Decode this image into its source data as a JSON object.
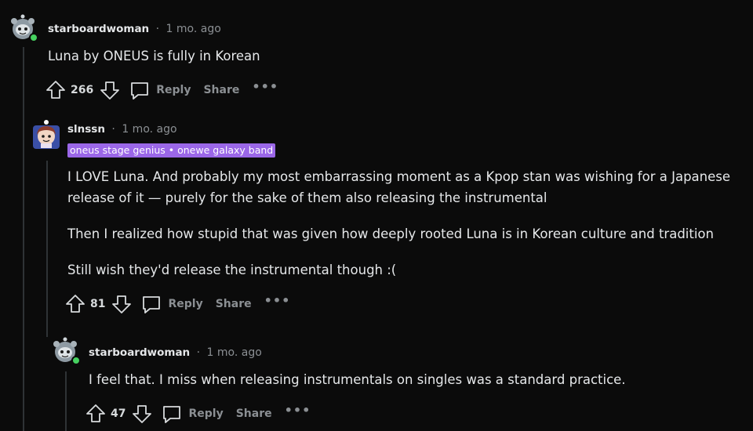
{
  "comments": [
    {
      "username": "starboardwoman",
      "separator": "·",
      "time": "1 mo. ago",
      "body": [
        "Luna by ONEUS is fully in Korean"
      ],
      "score": "266",
      "reply_label": "Reply",
      "share_label": "Share",
      "more_label": "•••"
    },
    {
      "username": "slnssn",
      "separator": "·",
      "time": "1 mo. ago",
      "flair": "oneus stage genius • onewe galaxy band",
      "body": [
        "I LOVE Luna. And probably my most embarrassing moment as a Kpop stan was wishing for a Japanese",
        "release of it — purely for the sake of them also releasing the instrumental",
        "Then I realized how stupid that was given how deeply rooted Luna is in Korean culture and tradition",
        "Still wish they'd release the instrumental though :("
      ],
      "score": "81",
      "reply_label": "Reply",
      "share_label": "Share",
      "more_label": "•••"
    },
    {
      "username": "starboardwoman",
      "separator": "·",
      "time": "1 mo. ago",
      "body": [
        "I feel that. I miss when releasing instrumentals on singles was a standard practice."
      ],
      "score": "47",
      "reply_label": "Reply",
      "share_label": "Share",
      "more_label": "•••"
    }
  ],
  "colors": {
    "background": "#0b0b0b",
    "flair_bg": "#9b67e8",
    "online_dot": "#46d160",
    "muted": "#8b8f93"
  }
}
